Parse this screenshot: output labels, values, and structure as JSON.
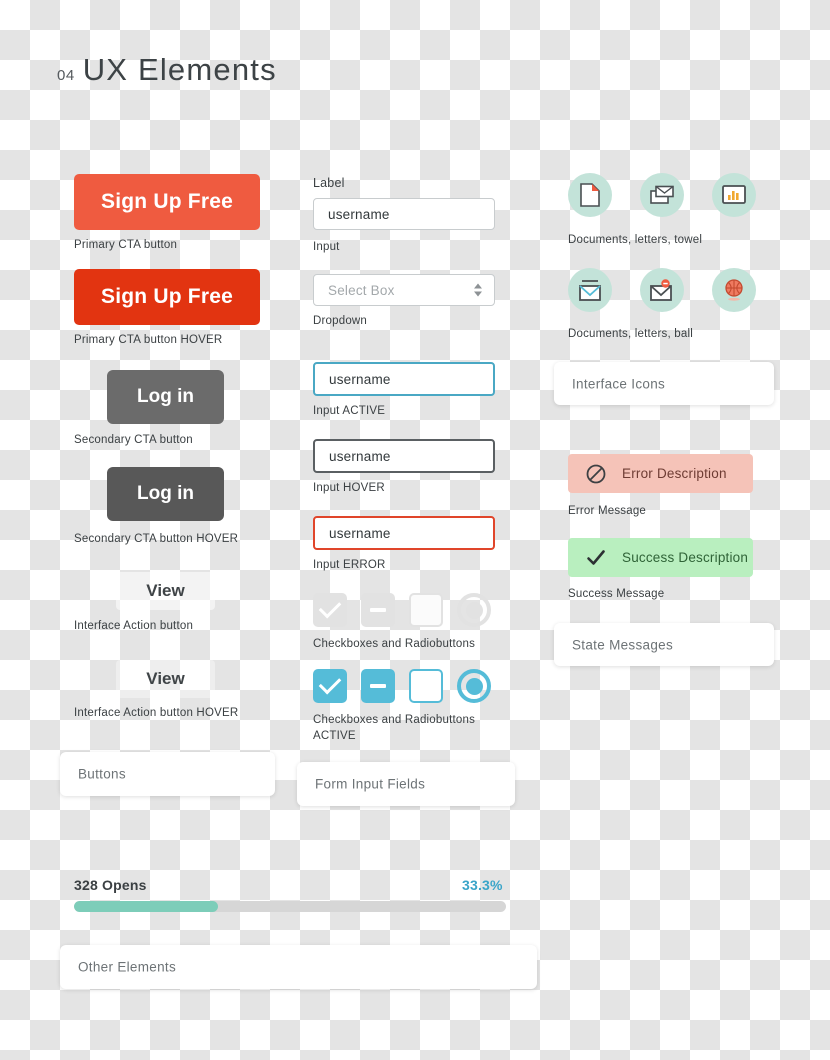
{
  "page": {
    "number": "04",
    "title": "UX Elements"
  },
  "colors": {
    "primary_cta": "#ef5b40",
    "primary_cta_hover": "#e23411",
    "secondary_cta": "#6b6b6b",
    "secondary_cta_hover": "#585858",
    "accent_teal": "#55bcd8",
    "input_active_border": "#4aa8c4",
    "input_hover_border": "#5a5f62",
    "input_error_border": "#e0452a",
    "error_bg": "#f5c3b8",
    "error_text": "#6e3c33",
    "success_bg": "#b9efbf",
    "success_text": "#2f6337",
    "icon_circle_bg": "#c3e3d9",
    "progress_fill": "#7dcdb9",
    "progress_track": "#d6d6d6",
    "progress_pct_text": "#3aa5c9"
  },
  "buttons_column": {
    "card_label": "Buttons",
    "items": [
      {
        "label": "Sign Up Free",
        "caption": "Primary CTA button",
        "style": "primary"
      },
      {
        "label": "Sign Up Free",
        "caption": "Primary CTA button HOVER",
        "style": "primary-hover"
      },
      {
        "label": "Log in",
        "caption": "Secondary CTA button",
        "style": "secondary"
      },
      {
        "label": "Log in",
        "caption": "Secondary CTA button HOVER",
        "style": "secondary-hover"
      },
      {
        "label": "View",
        "caption": "Interface Action button",
        "style": "ghost"
      },
      {
        "label": "View",
        "caption": "Interface Action button HOVER",
        "style": "ghost-hover"
      }
    ]
  },
  "form_column": {
    "card_label": "Form Input Fields",
    "label_text": "Label",
    "fields": [
      {
        "value": "username",
        "caption": "Input",
        "state": "default"
      },
      {
        "value": "Select Box",
        "caption": "Dropdown",
        "state": "select"
      },
      {
        "value": "username",
        "caption": "Input ACTIVE",
        "state": "active"
      },
      {
        "value": "username",
        "caption": "Input HOVER",
        "state": "hover"
      },
      {
        "value": "username",
        "caption": "Input ERROR",
        "state": "error"
      }
    ],
    "controls": [
      {
        "caption": "Checkboxes and Radiobuttons",
        "state": "inactive"
      },
      {
        "caption": "Checkboxes and Radiobuttons ACTIVE",
        "state": "active"
      }
    ]
  },
  "icons_column": {
    "card_label": "Interface Icons",
    "rows": [
      {
        "caption": "Documents, letters, towel",
        "icons": [
          "document-page-icon",
          "letter-stack-icon",
          "bar-chart-monitor-icon"
        ]
      },
      {
        "caption": "Documents, letters, ball",
        "icons": [
          "envelope-open-icon",
          "envelope-alert-icon",
          "basketball-icon"
        ]
      }
    ]
  },
  "state_messages": {
    "card_label": "State Messages",
    "items": [
      {
        "text": "Error Description",
        "caption": "Error Message",
        "icon": "no-entry-icon",
        "type": "error"
      },
      {
        "text": "Success Description",
        "caption": "Success Message",
        "icon": "check-icon",
        "type": "success"
      }
    ]
  },
  "other_elements": {
    "card_label": "Other Elements",
    "progress": {
      "title": "328 Opens",
      "percent_label": "33.3%",
      "percent_value": 33.3
    }
  }
}
